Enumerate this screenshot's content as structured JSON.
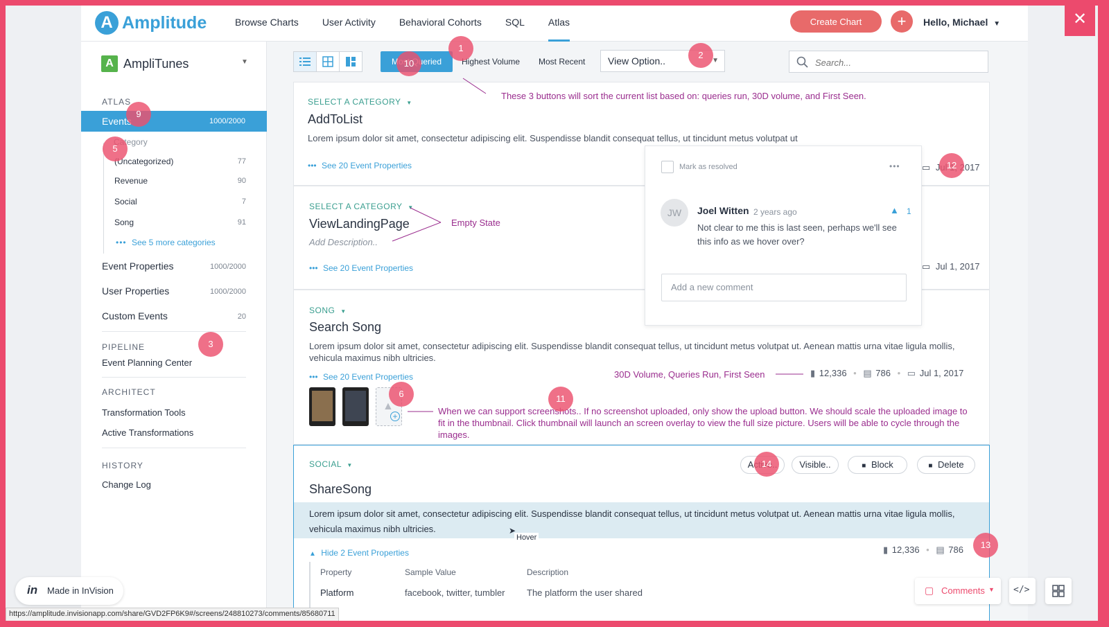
{
  "nav": {
    "logo_text": "Amplitude",
    "links": [
      "Browse Charts",
      "User Activity",
      "Behavioral Cohorts",
      "SQL",
      "Atlas"
    ],
    "create_chart": "Create Chart",
    "plus": "+",
    "greeting": "Hello, Michael"
  },
  "sidebar": {
    "project_badge": "A",
    "project_name": "AmpliTunes",
    "atlas_head": "ATLAS",
    "events": {
      "label": "Events",
      "count": "1000/2000"
    },
    "category_title": "Category",
    "categories": [
      {
        "label": "(Uncategorized)",
        "count": "77"
      },
      {
        "label": "Revenue",
        "count": "90"
      },
      {
        "label": "Social",
        "count": "7"
      },
      {
        "label": "Song",
        "count": "91"
      }
    ],
    "see_more": "See 5 more categories",
    "event_properties": {
      "label": "Event Properties",
      "count": "1000/2000"
    },
    "user_properties": {
      "label": "User Properties",
      "count": "1000/2000"
    },
    "custom_events": {
      "label": "Custom Events",
      "count": "20"
    },
    "pipeline_head": "PIPELINE",
    "event_planning": "Event Planning Center",
    "architect_head": "ARCHITECT",
    "transformation_tools": "Transformation Tools",
    "active_transformations": "Active Transformations",
    "history_head": "HISTORY",
    "change_log": "Change Log"
  },
  "toolbar": {
    "most_queried": "Most Queried",
    "highest_volume": "Highest Volume",
    "most_recent": "Most Recent",
    "view_option": "View Option..",
    "search_placeholder": "Search..."
  },
  "cards": [
    {
      "category": "SELECT A CATEGORY",
      "name": "AddToList",
      "desc": "Lorem ipsum dolor sit amet, consectetur adipiscing elit. Suspendisse blandit consequat tellus, ut tincidunt metus volutpat ut",
      "props": "See 20 Event Properties",
      "date": "Jul 1, 2017"
    },
    {
      "category": "SELECT A CATEGORY",
      "name": "ViewLandingPage",
      "desc": "Add Description..",
      "props": "See 20 Event Properties",
      "date": "Jul 1, 2017"
    },
    {
      "category": "SONG",
      "name": "Search Song",
      "desc": "Lorem ipsum dolor sit amet, consectetur adipiscing elit. Suspendisse blandit consequat tellus, ut tincidunt metus volutpat ut. Aenean mattis urna vitae ligula mollis, vehicula maximus nibh ultricies.",
      "props": "See 20 Event Properties",
      "volume": "12,336",
      "queries": "786",
      "date": "Jul 1, 2017"
    },
    {
      "category": "SOCIAL",
      "name": "ShareSong",
      "desc": "Lorem ipsum dolor sit amet, consectetur adipiscing elit. Suspendisse blandit consequat tellus, ut tincidunt metus volutpat ut. Aenean mattis urna vitae ligula mollis, vehicula maximus nibh ultricies.",
      "props": "Hide 2 Event Properties",
      "volume": "12,336",
      "queries": "786"
    }
  ],
  "card4": {
    "active": "Active..",
    "visible": "Visible..",
    "block": "Block",
    "delete": "Delete",
    "hover": "Hover",
    "table_headers": [
      "Property",
      "Sample Value",
      "Description"
    ],
    "row": {
      "property": "Platform",
      "sample": "facebook, twitter, tumbler",
      "description": "The platform the user shared"
    }
  },
  "comment": {
    "mark_resolved": "Mark as resolved",
    "initials": "JW",
    "author": "Joel Witten",
    "time": "2 years ago",
    "likes": "1",
    "text": "Not clear to me this is last seen, perhaps we'll see this info as we hover over?",
    "placeholder": "Add a new comment"
  },
  "annotations": {
    "sort_note": "These 3 buttons will sort the current list based on: queries run, 30D volume, and First Seen.",
    "empty_state": "Empty State",
    "meta_note": "30D Volume, Queries Run, First Seen",
    "screenshot_note": "When we can support screenshots.. If no screenshot uploaded, only show the upload button. We should scale the uploaded image to fit in the thumbnail. Click thumbnail will launch an screen overlay to view the full size picture. Users will be able to cycle through the images."
  },
  "pins": [
    "1",
    "2",
    "3",
    "5",
    "6",
    "9",
    "10",
    "11",
    "12",
    "13",
    "14"
  ],
  "footer": {
    "invision": "Made in InVision",
    "url": "https://amplitude.invisionapp.com/share/GVD2FP6K9#/screens/248810273/comments/85680711",
    "comments": "Comments"
  },
  "colors": {
    "accent": "#3aa0d8",
    "frame": "#ec4a6d",
    "annotation": "#9a2d8e",
    "create": "#e86a6a"
  }
}
